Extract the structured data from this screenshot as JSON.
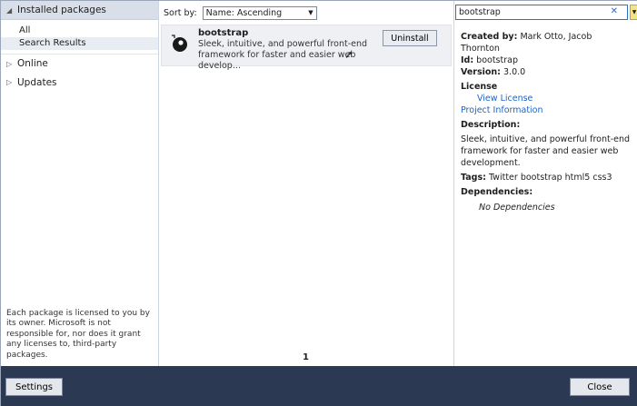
{
  "nav": {
    "installed": "Installed packages",
    "sub_items": [
      "All",
      "Search Results"
    ],
    "online": "Online",
    "updates": "Updates",
    "license_text": "Each package is licensed to you by its owner. Microsoft is not responsible for, nor does it grant any licenses to, third-party packages."
  },
  "sort": {
    "label": "Sort by:",
    "value": "Name: Ascending"
  },
  "package": {
    "name": "bootstrap",
    "description": "Sleek, intuitive, and powerful front-end framework for faster and easier web develop...",
    "action": "Uninstall"
  },
  "pager": {
    "current": "1"
  },
  "search": {
    "value": "bootstrap",
    "clear": "✕"
  },
  "details": {
    "created_by_label": "Created by:",
    "created_by": "Mark Otto, Jacob Thornton",
    "id_label": "Id:",
    "id": "bootstrap",
    "version_label": "Version:",
    "version": "3.0.0",
    "license_label": "License",
    "view_license": "View License",
    "project_info": "Project Information",
    "description_label": "Description:",
    "description": "Sleek, intuitive, and powerful front-end framework for faster and easier web development.",
    "tags_label": "Tags:",
    "tags": "Twitter bootstrap html5 css3",
    "dependencies_label": "Dependencies:",
    "dependencies": "No Dependencies"
  },
  "buttons": {
    "settings": "Settings",
    "close": "Close"
  },
  "colors": {
    "accent": "#1e64c8",
    "bottom_bar": "#2b3a52"
  }
}
